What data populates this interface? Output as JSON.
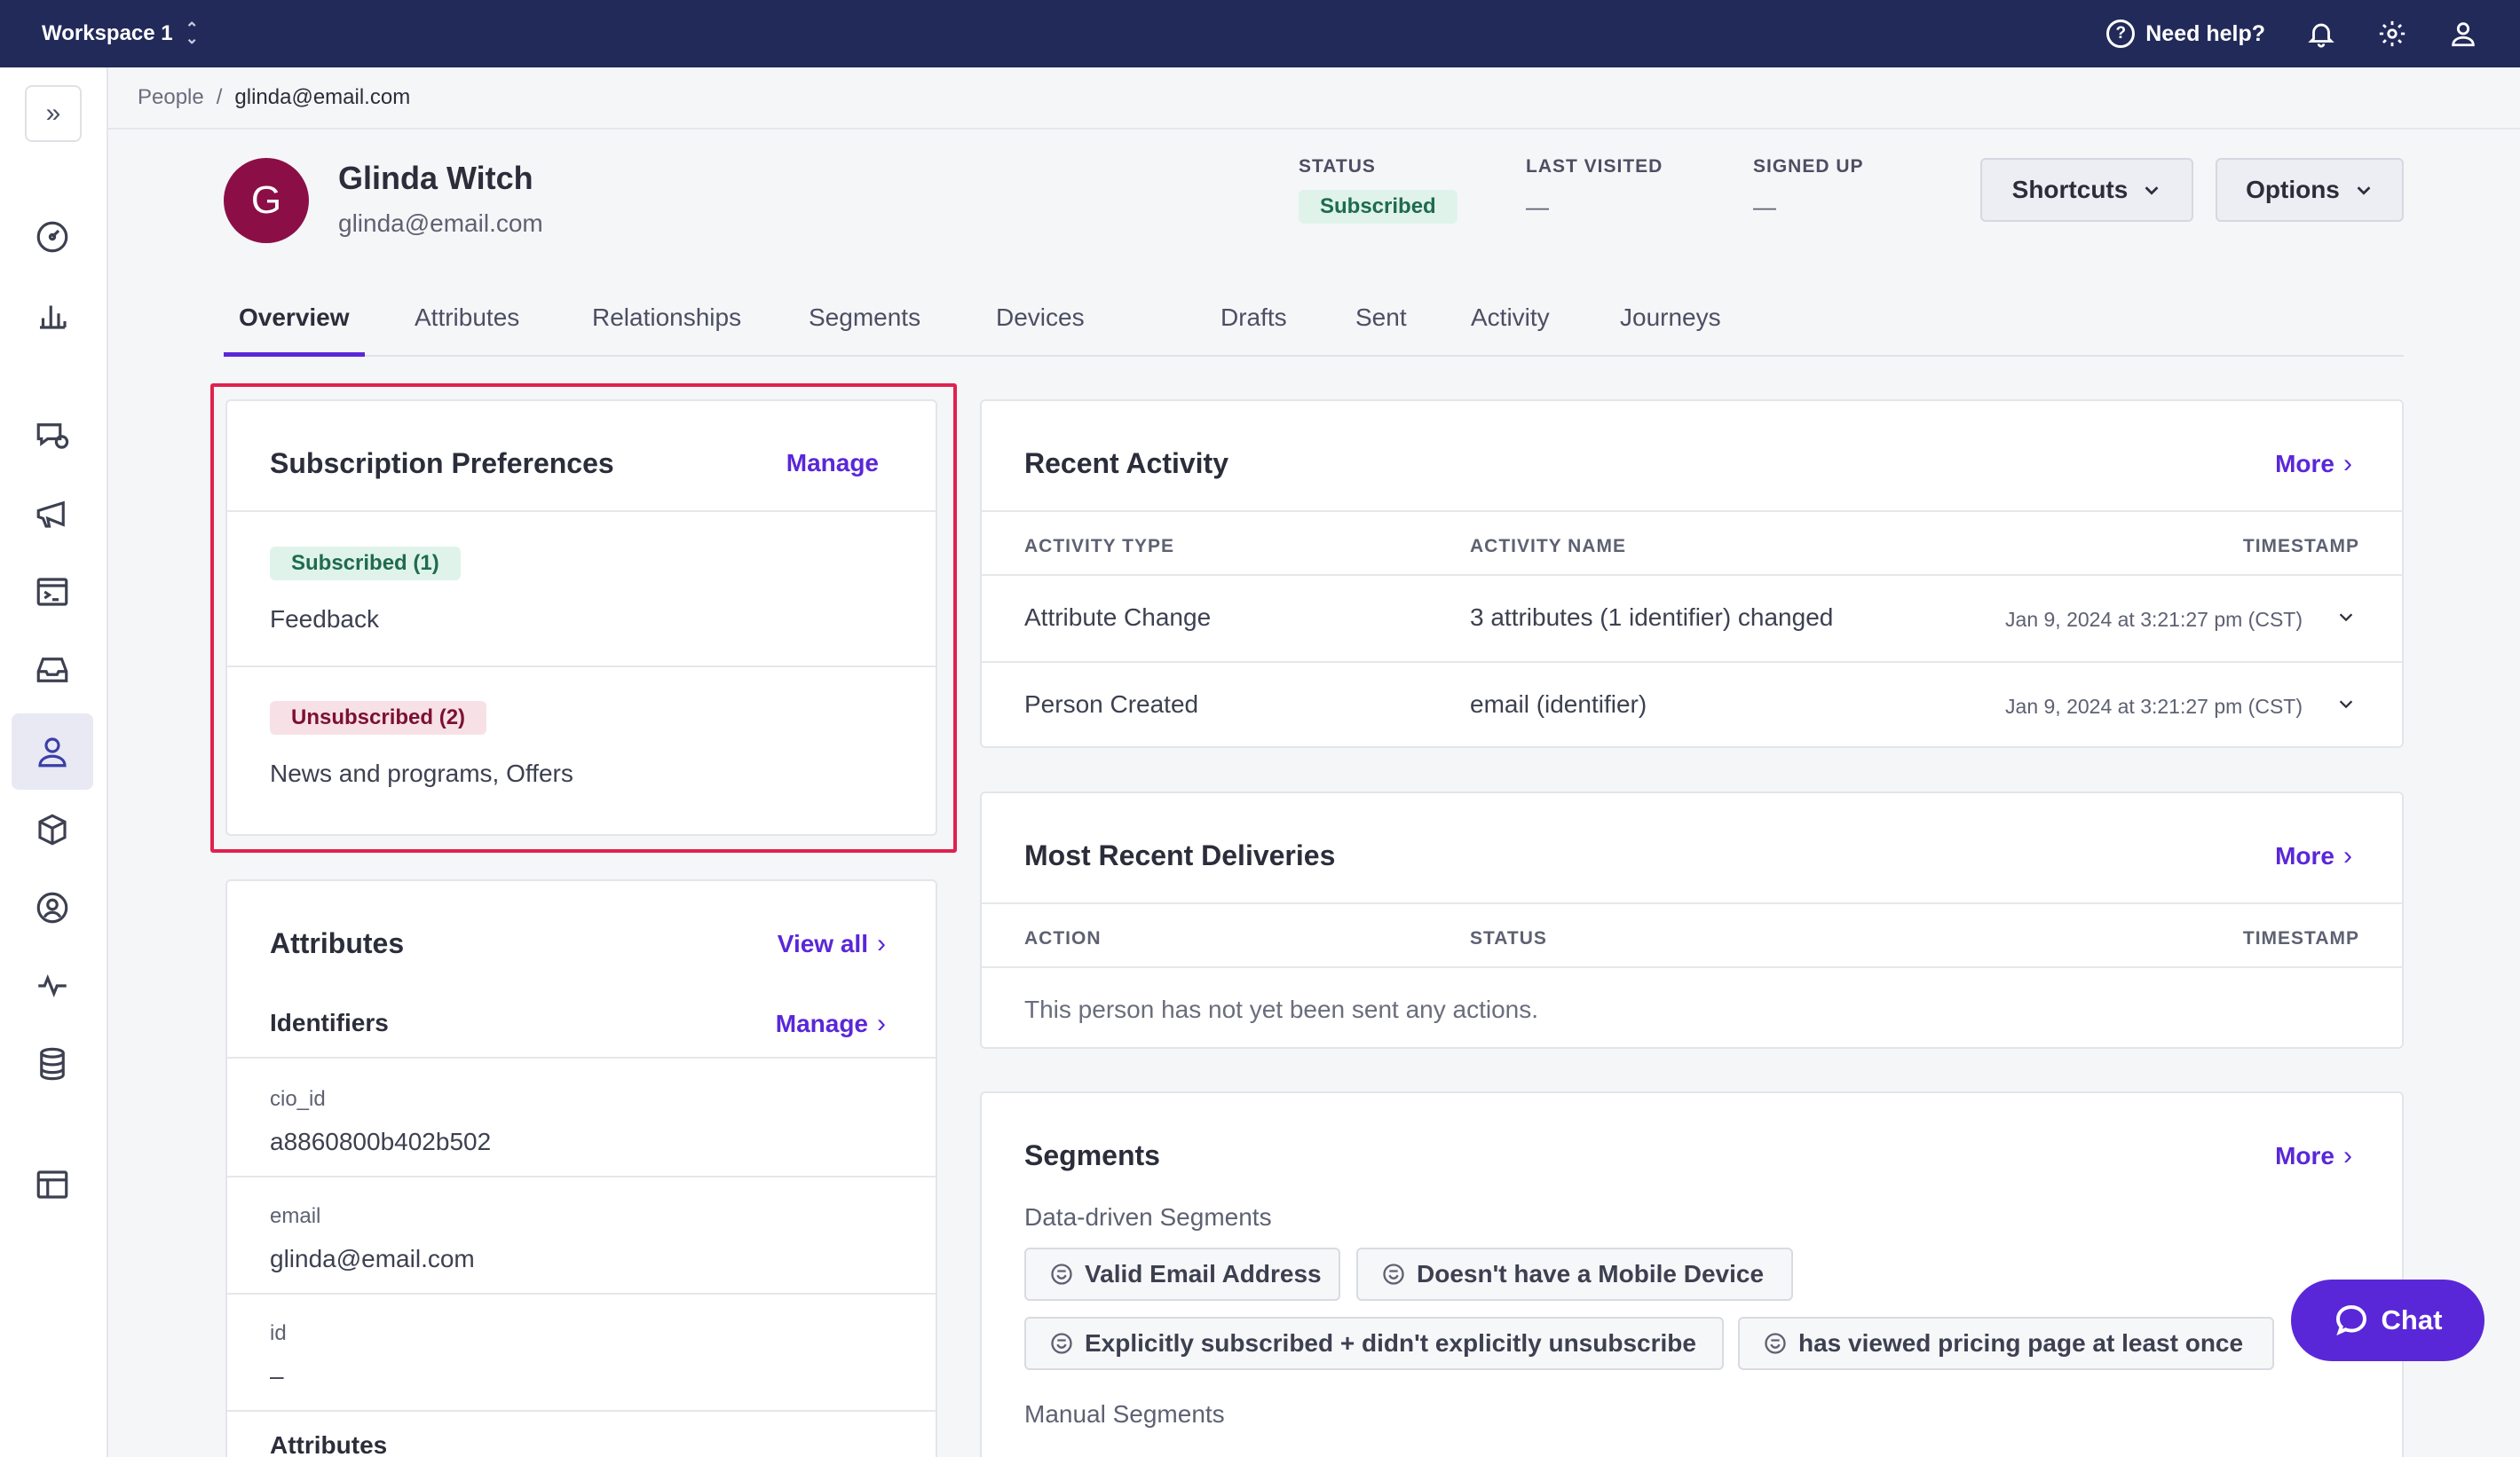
{
  "topbar": {
    "workspace": "Workspace 1",
    "help": "Need help?"
  },
  "breadcrumb": {
    "root": "People",
    "sep": "/",
    "current": "glinda@email.com"
  },
  "person": {
    "initial": "G",
    "name": "Glinda Witch",
    "email": "glinda@email.com",
    "status_label": "STATUS",
    "status_value": "Subscribed",
    "last_visited_label": "LAST VISITED",
    "last_visited_value": "—",
    "signed_up_label": "SIGNED UP",
    "signed_up_value": "—"
  },
  "actions": {
    "shortcuts": "Shortcuts",
    "options": "Options"
  },
  "tabs": [
    "Overview",
    "Attributes",
    "Relationships",
    "Segments",
    "Devices",
    "Drafts",
    "Sent",
    "Activity",
    "Journeys"
  ],
  "subscription": {
    "title": "Subscription Preferences",
    "manage": "Manage",
    "subscribed_tag": "Subscribed (1)",
    "subscribed_items": "Feedback",
    "unsubscribed_tag": "Unsubscribed (2)",
    "unsubscribed_items": "News and programs, Offers"
  },
  "attributes": {
    "title": "Attributes",
    "view_all": "View all",
    "identifiers_title": "Identifiers",
    "manage": "Manage",
    "fields": [
      {
        "label": "cio_id",
        "value": "a8860800b402b502"
      },
      {
        "label": "email",
        "value": "glinda@email.com"
      },
      {
        "label": "id",
        "value": "–"
      }
    ],
    "attributes_subtitle": "Attributes"
  },
  "recent_activity": {
    "title": "Recent Activity",
    "more": "More",
    "columns": [
      "ACTIVITY TYPE",
      "ACTIVITY NAME",
      "TIMESTAMP"
    ],
    "rows": [
      {
        "type": "Attribute Change",
        "name": "3 attributes (1 identifier) changed",
        "timestamp": "Jan 9, 2024 at 3:21:27 pm (CST)"
      },
      {
        "type": "Person Created",
        "name": "email (identifier)",
        "timestamp": "Jan 9, 2024 at 3:21:27 pm (CST)"
      }
    ]
  },
  "deliveries": {
    "title": "Most Recent Deliveries",
    "more": "More",
    "columns": [
      "ACTION",
      "STATUS",
      "TIMESTAMP"
    ],
    "empty": "This person has not yet been sent any actions."
  },
  "segments": {
    "title": "Segments",
    "more": "More",
    "data_driven_title": "Data-driven Segments",
    "chips": [
      "Valid Email Address",
      "Doesn't have a Mobile Device",
      "Explicitly subscribed + didn't explicitly unsubscribe",
      "has viewed pricing page at least once"
    ],
    "manual_title": "Manual Segments"
  },
  "chat": {
    "label": "Chat"
  }
}
